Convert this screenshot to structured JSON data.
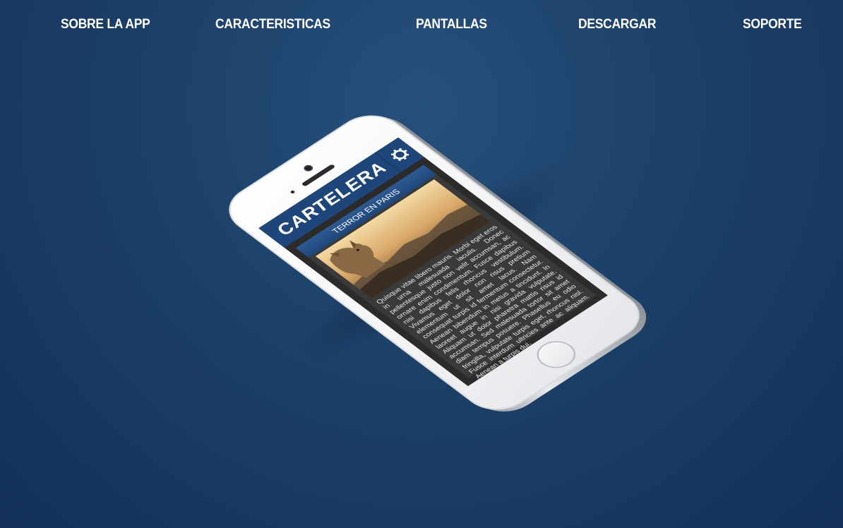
{
  "nav": {
    "items": [
      {
        "label": "SOBRE LA APP"
      },
      {
        "label": "CARACTERISTICAS"
      },
      {
        "label": "PANTALLAS"
      },
      {
        "label": "DESCARGAR"
      },
      {
        "label": "SOPORTE"
      }
    ]
  },
  "app": {
    "title": "CARTELERA",
    "settings_icon": "gear-icon",
    "card": {
      "title": "TERROR EN PARIS",
      "body": "Quisque vitae libero mauris. Morbi eget eros in urna malesuada iaculis. Donec pellentesque justo non velit accumsan, ac ornare enim condimentum. Fusce dapibus nisi dapibus felis rhoncus vestibulum. Vivamus eget dolor non risus pretium elementum ut sit amet lacus. Nam consequat turpis id fermentum consectetur. Aenean bibendum in metus a tincidunt. In laoreet augue in nisi gravida vulputate. Aliquam ut dolor pharetra mattis risus id accumsan. Sed malesuada tortor sit amet diam tempus posuere. Phasellus eu odio fringilla, vulputate turpis eget, rhoncus nisl. Fusce interdum ultricies ante ac aliquam. Aenean a turpis dui."
    }
  },
  "colors": {
    "background": "#1c4068",
    "app_header": "#1f467a",
    "nav_text": "#ffffff"
  }
}
